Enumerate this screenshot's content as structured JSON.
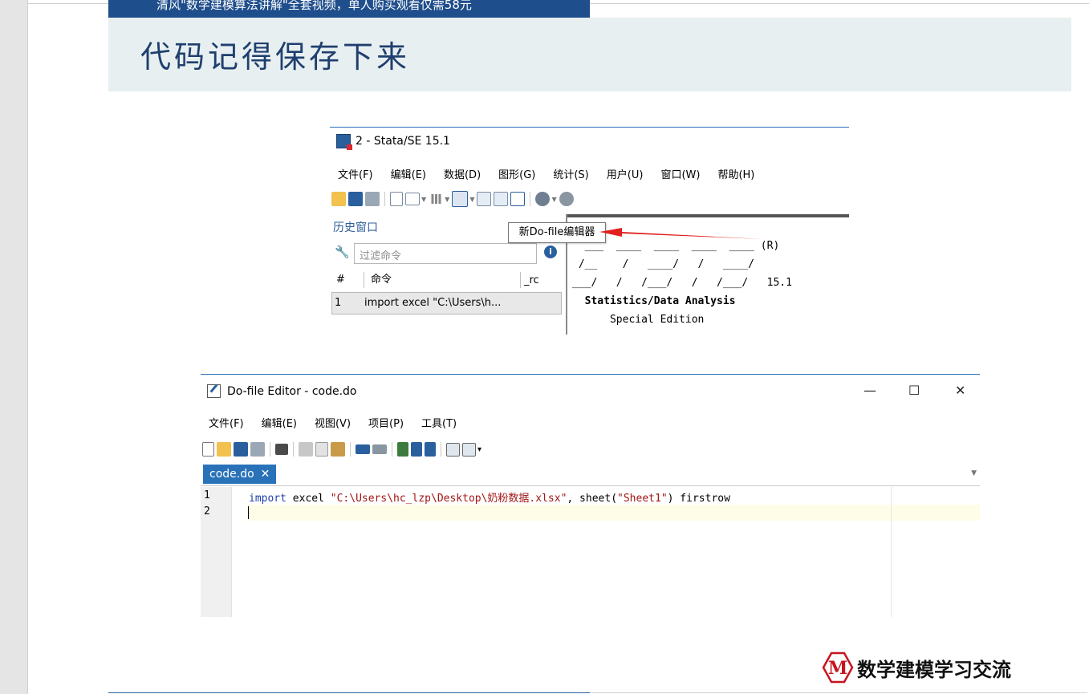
{
  "banner": {
    "text": "清风\"数学建模算法讲解\"全套视频，单人购买观看仅需58元"
  },
  "slide_title": "代码记得保存下来",
  "stata_window": {
    "title": "2 - Stata/SE 15.1",
    "menu": [
      "文件(F)",
      "编辑(E)",
      "数据(D)",
      "图形(G)",
      "统计(S)",
      "用户(U)",
      "窗口(W)",
      "帮助(H)"
    ],
    "history_title": "历史窗口",
    "filter_placeholder": "过滤命令",
    "table_headers": [
      "#",
      "命令",
      "_rc"
    ],
    "history_rows": [
      {
        "num": "1",
        "command": "import excel \"C:\\Users\\h..."
      }
    ],
    "tooltip": "新Do-file编辑器",
    "results": {
      "line1": "  ___  ____  ____  ____  ____ (R)",
      "line2": " /__    /   ____/   /   ____/",
      "line3": "___/   /   /___/   /   /___/   15.1",
      "line4": "  Statistics/Data Analysis",
      "line5": "      Special Edition"
    }
  },
  "dofile_editor": {
    "title": "Do-file Editor - code.do",
    "controls": {
      "minimize": "—",
      "maximize": "☐",
      "close": "✕"
    },
    "menu": [
      "文件(F)",
      "编辑(E)",
      "视图(V)",
      "项目(P)",
      "工具(T)"
    ],
    "tab": {
      "label": "code.do",
      "close": "✕"
    },
    "line_numbers": [
      "1",
      "2"
    ],
    "code": {
      "keyword": "import",
      "part1": " excel ",
      "string1": "\"C:\\Users\\hc_lzp\\Desktop\\奶粉数据.xlsx\"",
      "part2": ", sheet(",
      "string2": "\"Sheet1\"",
      "part3": ") firstrow"
    }
  },
  "brand": {
    "logo_letter": "M",
    "text": "数学建模学习交流"
  },
  "colors": {
    "banner_bg": "#1f4e8c",
    "title_band": "#e8eff1",
    "title_text": "#1f3f6e",
    "tab_blue": "#2a72b8",
    "arrow_red": "#e0201e",
    "logo_red": "#c8141e"
  }
}
